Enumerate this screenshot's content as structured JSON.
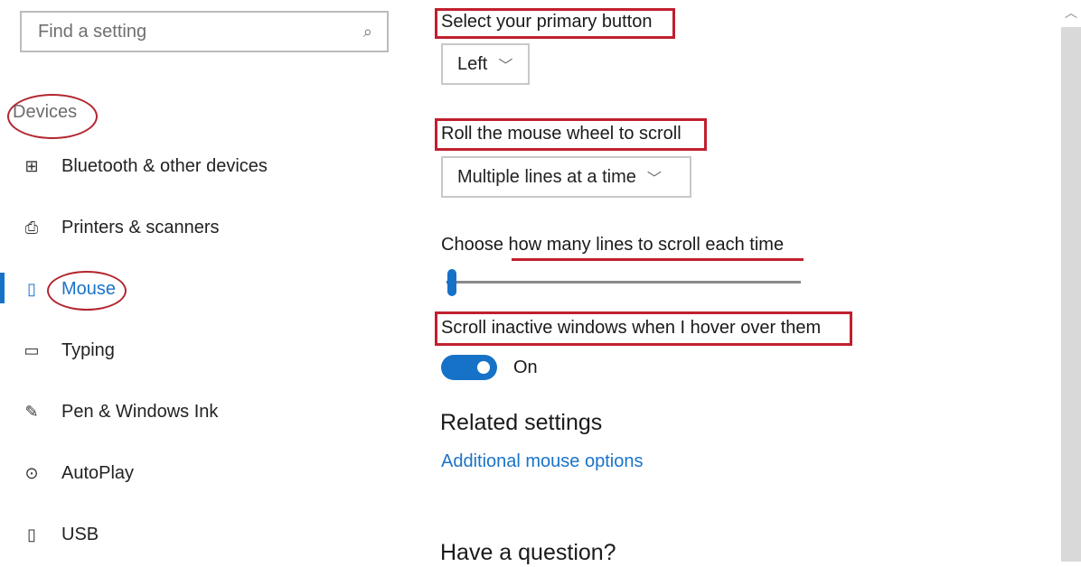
{
  "search": {
    "placeholder": "Find a setting",
    "icon": "search-icon"
  },
  "sidebar": {
    "section_label": "Devices",
    "items": [
      {
        "label": "Bluetooth & other devices",
        "icon": "bluetooth-devices-icon",
        "glyph": "⊞"
      },
      {
        "label": "Printers & scanners",
        "icon": "printer-icon",
        "glyph": "⎙"
      },
      {
        "label": "Mouse",
        "icon": "mouse-icon",
        "glyph": "▯",
        "active": true
      },
      {
        "label": "Typing",
        "icon": "keyboard-icon",
        "glyph": "▭"
      },
      {
        "label": "Pen & Windows Ink",
        "icon": "pen-icon",
        "glyph": "✎"
      },
      {
        "label": "AutoPlay",
        "icon": "autoplay-icon",
        "glyph": "⊙"
      },
      {
        "label": "USB",
        "icon": "usb-icon",
        "glyph": "▯"
      }
    ]
  },
  "main": {
    "primary_button": {
      "label": "Select your primary button",
      "value": "Left"
    },
    "wheel_scroll": {
      "label": "Roll the mouse wheel to scroll",
      "value": "Multiple lines at a time"
    },
    "lines_slider": {
      "label": "Choose how many lines to scroll each time",
      "level_fraction": 0.02
    },
    "inactive_scroll": {
      "label": "Scroll inactive windows when I hover over them",
      "state": "On"
    },
    "related": {
      "heading": "Related settings",
      "link": "Additional mouse options"
    },
    "question": {
      "heading": "Have a question?"
    }
  },
  "colors": {
    "accent": "#1572c7",
    "annotation": "#c0202d",
    "link": "#1a73c9"
  }
}
